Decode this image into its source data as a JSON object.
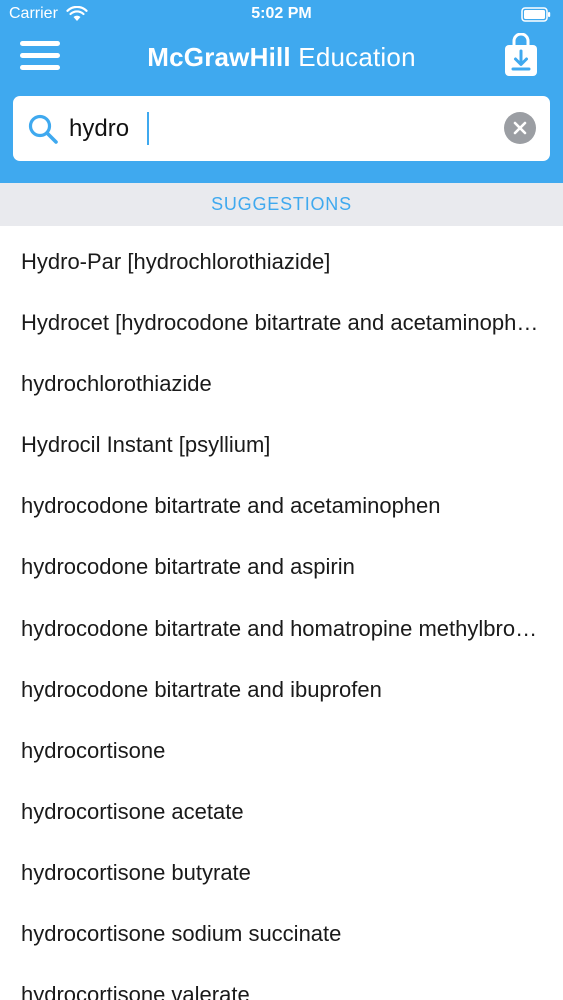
{
  "status_bar": {
    "carrier": "Carrier",
    "time": "5:02 PM"
  },
  "navbar": {
    "brand_strong": "McGrawHill",
    "brand_light": "Education"
  },
  "search": {
    "value": "hydro"
  },
  "suggestions": {
    "header": "SUGGESTIONS",
    "items": [
      "Hydro-Par [hydrochlorothiazide]",
      "Hydrocet [hydrocodone bitartrate and acetaminophen]",
      "hydrochlorothiazide",
      "Hydrocil Instant [psyllium]",
      "hydrocodone bitartrate and acetaminophen",
      "hydrocodone bitartrate and aspirin",
      "hydrocodone bitartrate and homatropine methylbromide",
      "hydrocodone bitartrate and ibuprofen",
      "hydrocortisone",
      "hydrocortisone acetate",
      "hydrocortisone butyrate",
      "hydrocortisone sodium succinate",
      "hydrocortisone valerate"
    ]
  },
  "colors": {
    "accent": "#3fa9ef",
    "section_bg": "#e9eaee"
  }
}
